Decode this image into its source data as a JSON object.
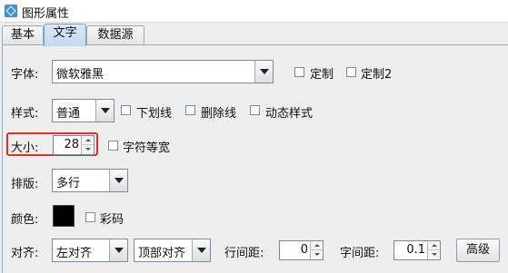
{
  "window": {
    "title": "图形属性"
  },
  "tabs": [
    {
      "label": "基本"
    },
    {
      "label": "文字"
    },
    {
      "label": "数据源"
    }
  ],
  "font": {
    "label": "字体:",
    "value": "微软雅黑",
    "custom_label": "定制",
    "custom2_label": "定制2"
  },
  "style": {
    "label": "样式:",
    "value": "普通",
    "underline_label": "下划线",
    "strikethrough_label": "删除线",
    "dynamic_label": "动态样式"
  },
  "size": {
    "label": "大小:",
    "value": "28",
    "monospace_label": "字符等宽"
  },
  "layout": {
    "label": "排版:",
    "value": "多行"
  },
  "color": {
    "label": "颜色:",
    "value": "#000000",
    "rainbow_label": "彩码"
  },
  "align": {
    "label": "对齐:",
    "horizontal_value": "左对齐",
    "vertical_value": "顶部对齐",
    "line_spacing_label": "行间距:",
    "line_spacing_value": "0",
    "char_spacing_label": "字间距:",
    "char_spacing_value": "0.1",
    "advanced_label": "高级"
  },
  "colors": {
    "highlight": "#e0302a",
    "active_tab": "#c5d9ef"
  }
}
